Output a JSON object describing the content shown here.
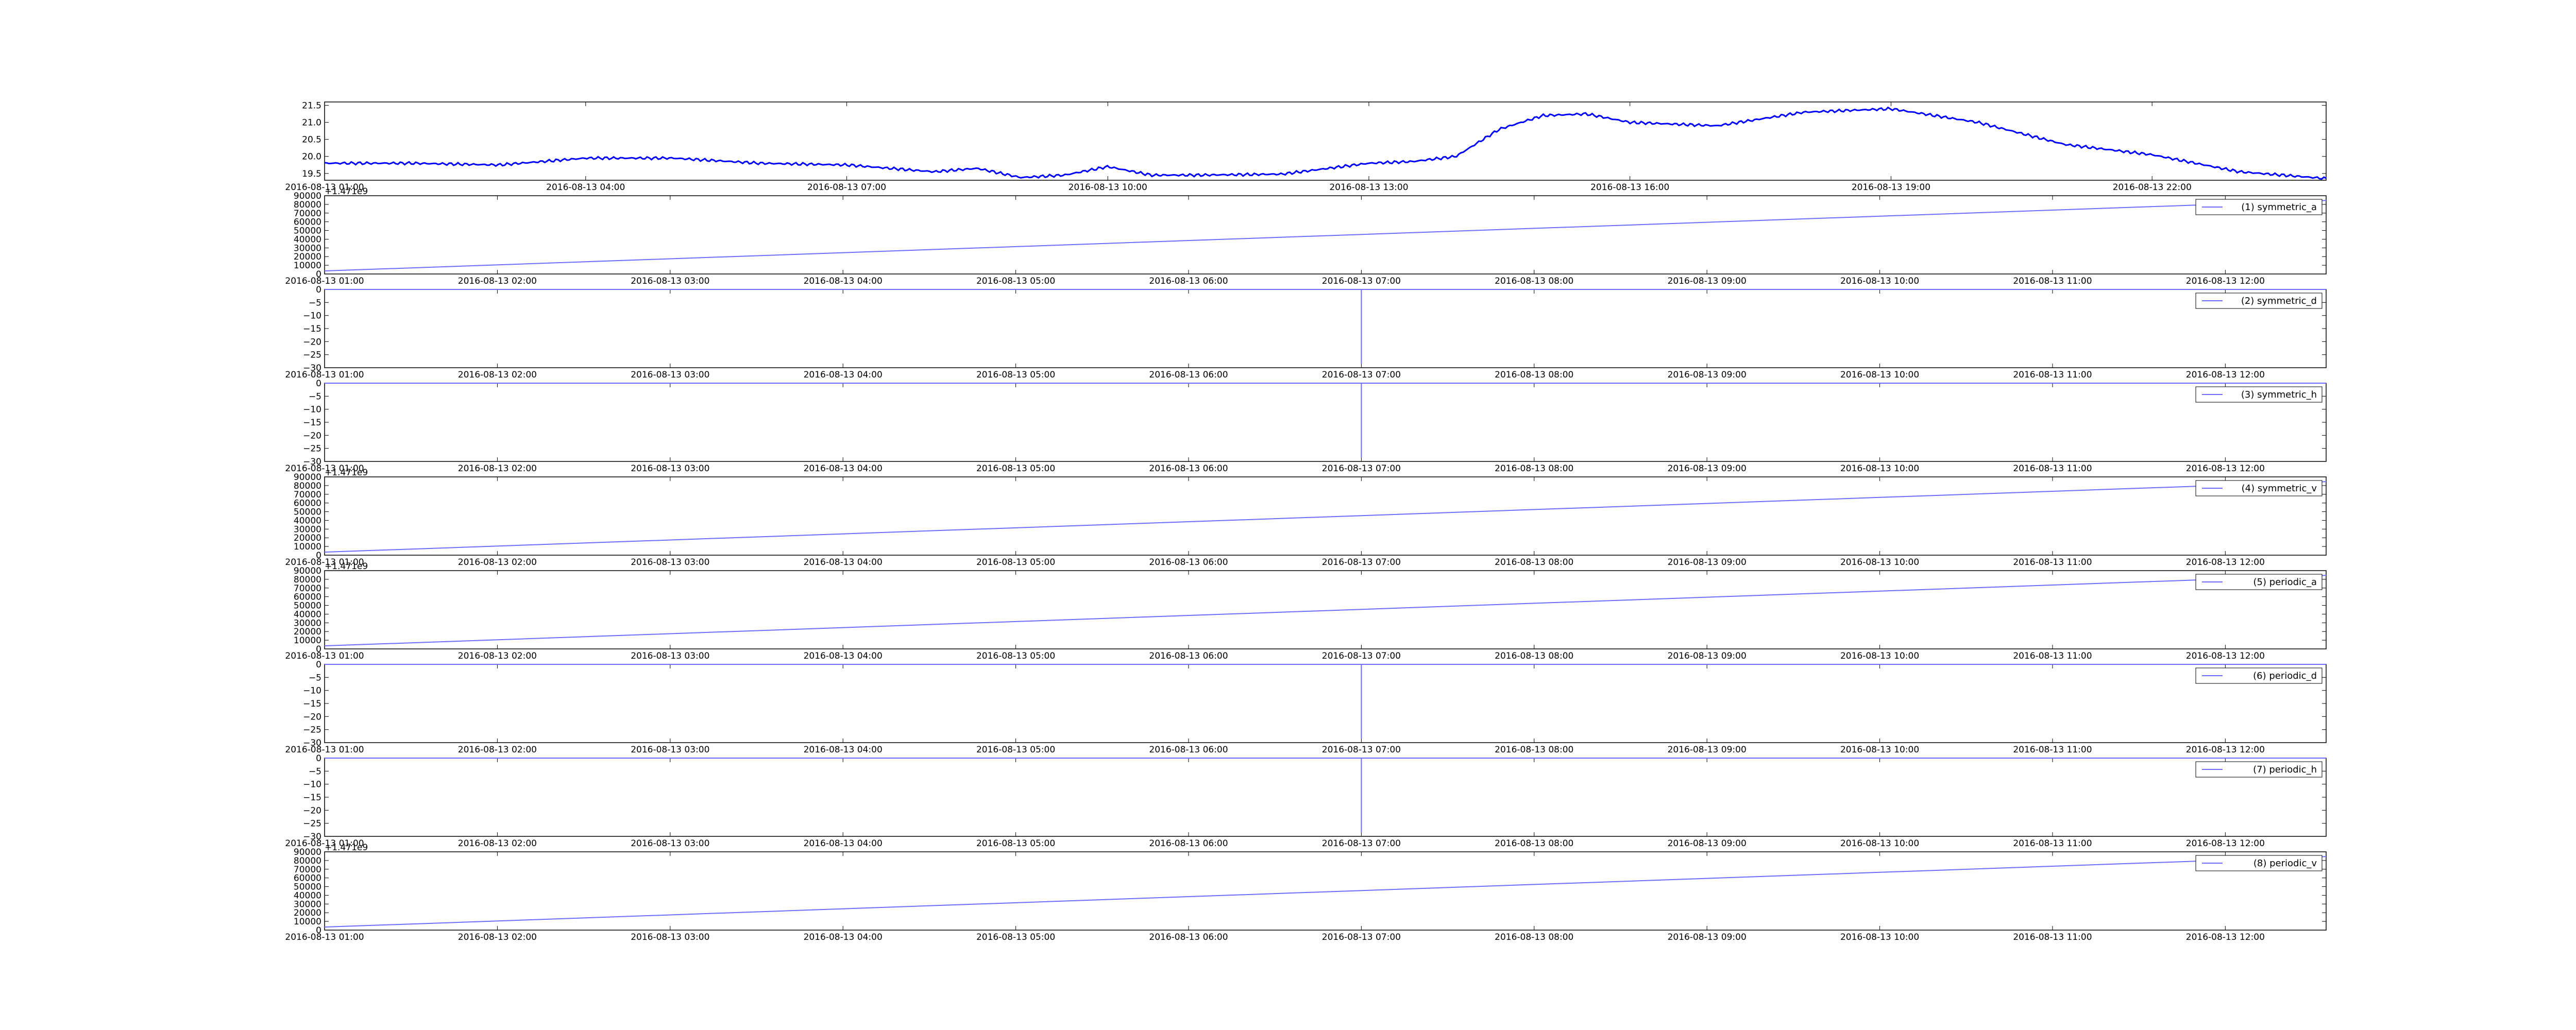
{
  "colors": {
    "temperature_line": "#0000ff",
    "series_line": "#6d6dff",
    "axes": "#000000",
    "background": "#ffffff"
  },
  "chart_data": [
    {
      "type": "line",
      "title": "",
      "xlabel": "",
      "ylabel": "",
      "legend": null,
      "grid": false,
      "x_range": [
        "2016-08-13 01:00",
        "2016-08-14 00:00"
      ],
      "y_range": [
        19.3,
        21.6
      ],
      "y_ticks": [
        "19.5",
        "20.0",
        "20.5",
        "21.0",
        "21.5"
      ],
      "x_tick_labels": [
        "2016-08-13 01:00",
        "2016-08-13 04:00",
        "2016-08-13 07:00",
        "2016-08-13 10:00",
        "2016-08-13 13:00",
        "2016-08-13 16:00",
        "2016-08-13 19:00",
        "2016-08-13 22:00"
      ],
      "series": [
        {
          "x": [
            "2016-08-13 01:00",
            "2016-08-13 02:00",
            "2016-08-13 03:00",
            "2016-08-13 04:00",
            "2016-08-13 05:00",
            "2016-08-13 06:00",
            "2016-08-13 07:00",
            "2016-08-13 08:00",
            "2016-08-13 08:30",
            "2016-08-13 09:00",
            "2016-08-13 09:30",
            "2016-08-13 10:00",
            "2016-08-13 10:30",
            "2016-08-13 11:00",
            "2016-08-13 12:00",
            "2016-08-13 13:00",
            "2016-08-13 13:30",
            "2016-08-13 14:00",
            "2016-08-13 14:30",
            "2016-08-13 15:00",
            "2016-08-13 15:30",
            "2016-08-13 16:00",
            "2016-08-13 17:00",
            "2016-08-13 18:00",
            "2016-08-13 19:00",
            "2016-08-13 20:00",
            "2016-08-13 21:00",
            "2016-08-13 22:00",
            "2016-08-13 23:00",
            "2016-08-14 00:00"
          ],
          "values": [
            19.8,
            19.8,
            19.75,
            19.95,
            19.95,
            19.8,
            19.75,
            19.55,
            19.65,
            19.38,
            19.45,
            19.7,
            19.45,
            19.45,
            19.48,
            19.8,
            19.85,
            20.0,
            20.8,
            21.2,
            21.25,
            21.0,
            20.9,
            21.3,
            21.4,
            21.0,
            20.35,
            20.05,
            19.55,
            19.35
          ]
        }
      ]
    },
    {
      "type": "line",
      "title": "",
      "xlabel": "",
      "ylabel": "",
      "offset_text": "+1.471e9",
      "y_range": [
        0,
        90000
      ],
      "y_ticks": [
        "0",
        "10000",
        "20000",
        "30000",
        "40000",
        "50000",
        "60000",
        "70000",
        "80000",
        "90000"
      ],
      "x_range": [
        "2016-08-13 01:00",
        "2016-08-13 12:35"
      ],
      "x_tick_labels": [
        "2016-08-13 01:00",
        "2016-08-13 02:00",
        "2016-08-13 03:00",
        "2016-08-13 04:00",
        "2016-08-13 05:00",
        "2016-08-13 06:00",
        "2016-08-13 07:00",
        "2016-08-13 08:00",
        "2016-08-13 09:00",
        "2016-08-13 10:00",
        "2016-08-13 11:00",
        "2016-08-13 12:00"
      ],
      "series": [
        {
          "name": "(1) symmetric_a",
          "x": [
            "2016-08-13 01:00",
            "2016-08-13 12:35"
          ],
          "values": [
            3500,
            84500
          ]
        }
      ]
    },
    {
      "type": "line",
      "title": "",
      "xlabel": "",
      "ylabel": "",
      "y_range": [
        -30,
        0
      ],
      "y_ticks": [
        "−30",
        "−25",
        "−20",
        "−15",
        "−10",
        "−5",
        "0"
      ],
      "x_range": [
        "2016-08-13 01:00",
        "2016-08-13 12:35"
      ],
      "x_tick_labels": [
        "2016-08-13 01:00",
        "2016-08-13 02:00",
        "2016-08-13 03:00",
        "2016-08-13 04:00",
        "2016-08-13 05:00",
        "2016-08-13 06:00",
        "2016-08-13 07:00",
        "2016-08-13 08:00",
        "2016-08-13 09:00",
        "2016-08-13 10:00",
        "2016-08-13 11:00",
        "2016-08-13 12:00"
      ],
      "series": [
        {
          "name": "(2) symmetric_d",
          "x": [
            "2016-08-13 01:00",
            "2016-08-13 07:00",
            "2016-08-13 07:00",
            "2016-08-13 07:00",
            "2016-08-13 12:35"
          ],
          "values": [
            0,
            0,
            -28.5,
            0,
            0
          ]
        }
      ]
    },
    {
      "type": "line",
      "title": "",
      "xlabel": "",
      "ylabel": "",
      "y_range": [
        -30,
        0
      ],
      "y_ticks": [
        "−30",
        "−25",
        "−20",
        "−15",
        "−10",
        "−5",
        "0"
      ],
      "x_range": [
        "2016-08-13 01:00",
        "2016-08-13 12:35"
      ],
      "x_tick_labels": [
        "2016-08-13 01:00",
        "2016-08-13 02:00",
        "2016-08-13 03:00",
        "2016-08-13 04:00",
        "2016-08-13 05:00",
        "2016-08-13 06:00",
        "2016-08-13 07:00",
        "2016-08-13 08:00",
        "2016-08-13 09:00",
        "2016-08-13 10:00",
        "2016-08-13 11:00",
        "2016-08-13 12:00"
      ],
      "series": [
        {
          "name": "(3) symmetric_h",
          "x": [
            "2016-08-13 01:00",
            "2016-08-13 07:00",
            "2016-08-13 07:00",
            "2016-08-13 07:00",
            "2016-08-13 12:35"
          ],
          "values": [
            0,
            0,
            -28.5,
            0,
            0
          ]
        }
      ]
    },
    {
      "type": "line",
      "title": "",
      "xlabel": "",
      "ylabel": "",
      "offset_text": "+1.471e9",
      "y_range": [
        0,
        90000
      ],
      "y_ticks": [
        "0",
        "10000",
        "20000",
        "30000",
        "40000",
        "50000",
        "60000",
        "70000",
        "80000",
        "90000"
      ],
      "x_range": [
        "2016-08-13 01:00",
        "2016-08-13 12:35"
      ],
      "x_tick_labels": [
        "2016-08-13 01:00",
        "2016-08-13 02:00",
        "2016-08-13 03:00",
        "2016-08-13 04:00",
        "2016-08-13 05:00",
        "2016-08-13 06:00",
        "2016-08-13 07:00",
        "2016-08-13 08:00",
        "2016-08-13 09:00",
        "2016-08-13 10:00",
        "2016-08-13 11:00",
        "2016-08-13 12:00"
      ],
      "series": [
        {
          "name": "(4) symmetric_v",
          "x": [
            "2016-08-13 01:00",
            "2016-08-13 12:35"
          ],
          "values": [
            3500,
            84500
          ]
        }
      ]
    },
    {
      "type": "line",
      "title": "",
      "xlabel": "",
      "ylabel": "",
      "offset_text": "+1.471e9",
      "y_range": [
        0,
        90000
      ],
      "y_ticks": [
        "0",
        "10000",
        "20000",
        "30000",
        "40000",
        "50000",
        "60000",
        "70000",
        "80000",
        "90000"
      ],
      "x_range": [
        "2016-08-13 01:00",
        "2016-08-13 12:35"
      ],
      "x_tick_labels": [
        "2016-08-13 01:00",
        "2016-08-13 02:00",
        "2016-08-13 03:00",
        "2016-08-13 04:00",
        "2016-08-13 05:00",
        "2016-08-13 06:00",
        "2016-08-13 07:00",
        "2016-08-13 08:00",
        "2016-08-13 09:00",
        "2016-08-13 10:00",
        "2016-08-13 11:00",
        "2016-08-13 12:00"
      ],
      "series": [
        {
          "name": "(5) periodic_a",
          "x": [
            "2016-08-13 01:00",
            "2016-08-13 12:35"
          ],
          "values": [
            3500,
            84500
          ]
        }
      ]
    },
    {
      "type": "line",
      "title": "",
      "xlabel": "",
      "ylabel": "",
      "y_range": [
        -30,
        0
      ],
      "y_ticks": [
        "−30",
        "−25",
        "−20",
        "−15",
        "−10",
        "−5",
        "0"
      ],
      "x_range": [
        "2016-08-13 01:00",
        "2016-08-13 12:35"
      ],
      "x_tick_labels": [
        "2016-08-13 01:00",
        "2016-08-13 02:00",
        "2016-08-13 03:00",
        "2016-08-13 04:00",
        "2016-08-13 05:00",
        "2016-08-13 06:00",
        "2016-08-13 07:00",
        "2016-08-13 08:00",
        "2016-08-13 09:00",
        "2016-08-13 10:00",
        "2016-08-13 11:00",
        "2016-08-13 12:00"
      ],
      "series": [
        {
          "name": "(6) periodic_d",
          "x": [
            "2016-08-13 01:00",
            "2016-08-13 07:00",
            "2016-08-13 07:00",
            "2016-08-13 07:00",
            "2016-08-13 12:35"
          ],
          "values": [
            0,
            0,
            -28.5,
            0,
            0
          ]
        }
      ]
    },
    {
      "type": "line",
      "title": "",
      "xlabel": "",
      "ylabel": "",
      "y_range": [
        -30,
        0
      ],
      "y_ticks": [
        "−30",
        "−25",
        "−20",
        "−15",
        "−10",
        "−5",
        "0"
      ],
      "x_range": [
        "2016-08-13 01:00",
        "2016-08-13 12:35"
      ],
      "x_tick_labels": [
        "2016-08-13 01:00",
        "2016-08-13 02:00",
        "2016-08-13 03:00",
        "2016-08-13 04:00",
        "2016-08-13 05:00",
        "2016-08-13 06:00",
        "2016-08-13 07:00",
        "2016-08-13 08:00",
        "2016-08-13 09:00",
        "2016-08-13 10:00",
        "2016-08-13 11:00",
        "2016-08-13 12:00"
      ],
      "series": [
        {
          "name": "(7) periodic_h",
          "x": [
            "2016-08-13 01:00",
            "2016-08-13 07:00",
            "2016-08-13 07:00",
            "2016-08-13 07:00",
            "2016-08-13 12:35"
          ],
          "values": [
            0,
            0,
            -28.5,
            0,
            0
          ]
        }
      ]
    },
    {
      "type": "line",
      "title": "",
      "xlabel": "",
      "ylabel": "",
      "offset_text": "+1.471e9",
      "y_range": [
        0,
        90000
      ],
      "y_ticks": [
        "0",
        "10000",
        "20000",
        "30000",
        "40000",
        "50000",
        "60000",
        "70000",
        "80000",
        "90000"
      ],
      "x_range": [
        "2016-08-13 01:00",
        "2016-08-13 12:35"
      ],
      "x_tick_labels": [
        "2016-08-13 01:00",
        "2016-08-13 02:00",
        "2016-08-13 03:00",
        "2016-08-13 04:00",
        "2016-08-13 05:00",
        "2016-08-13 06:00",
        "2016-08-13 07:00",
        "2016-08-13 08:00",
        "2016-08-13 09:00",
        "2016-08-13 10:00",
        "2016-08-13 11:00",
        "2016-08-13 12:00"
      ],
      "series": [
        {
          "name": "(8) periodic_v",
          "x": [
            "2016-08-13 01:00",
            "2016-08-13 12:35"
          ],
          "values": [
            3500,
            84500
          ]
        }
      ]
    }
  ]
}
